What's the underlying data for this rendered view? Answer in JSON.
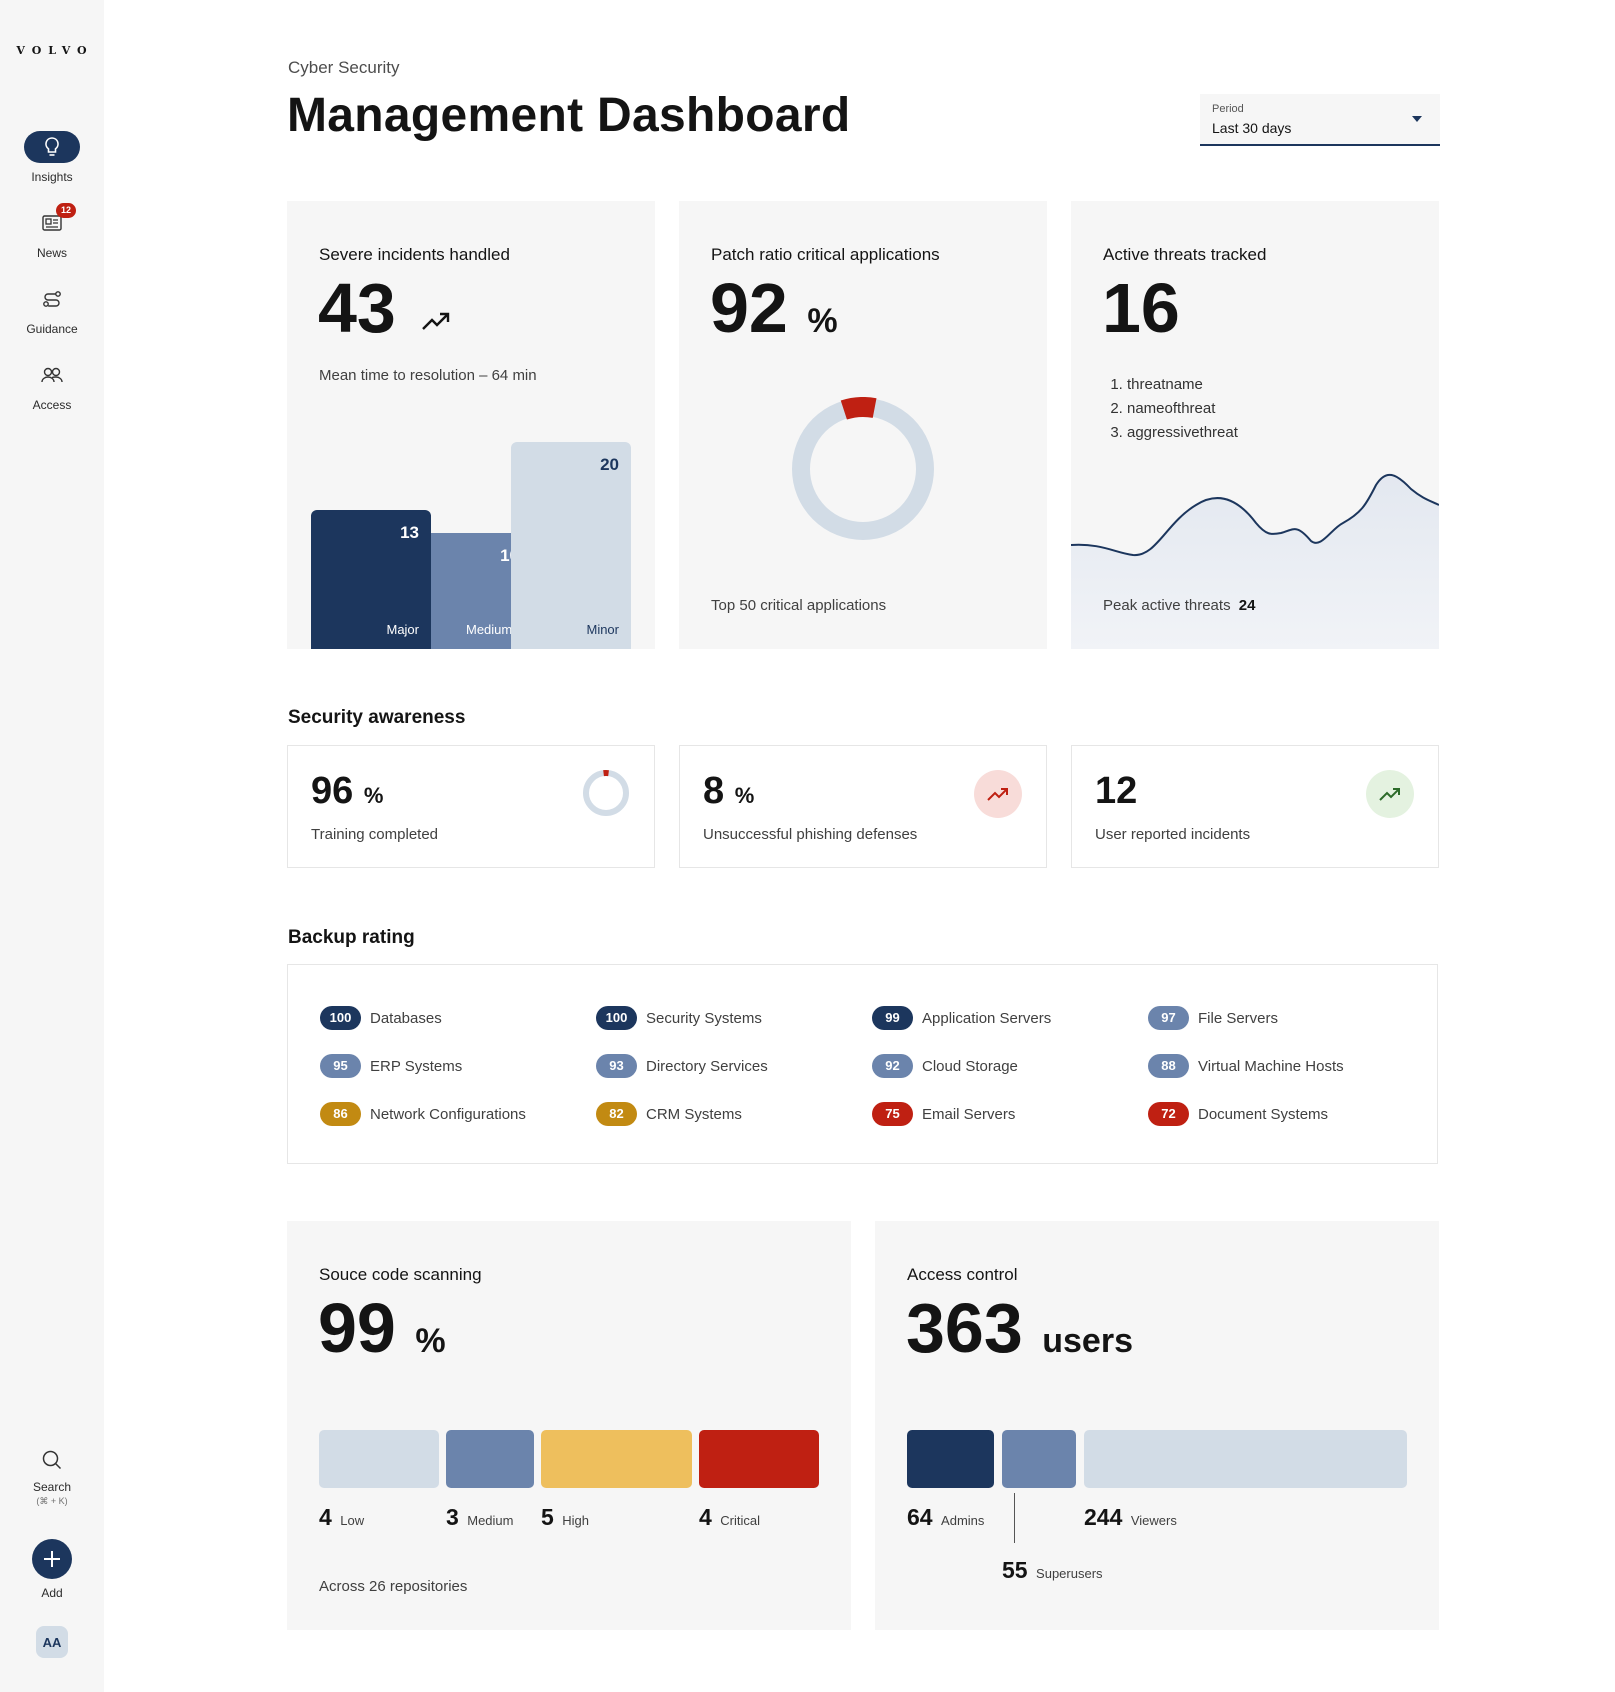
{
  "brand": "VOLVO",
  "colors": {
    "navy": "#1c365d",
    "slate": "#6b84ac",
    "light": "#d2dce6",
    "amber": "#eebf5d",
    "red": "#bf2012",
    "gold": "#c28a12"
  },
  "sidebar": {
    "items": [
      {
        "label": "Insights",
        "icon": "lightbulb-icon",
        "active": true
      },
      {
        "label": "News",
        "icon": "newspaper-icon",
        "badge": "12"
      },
      {
        "label": "Guidance",
        "icon": "route-icon"
      },
      {
        "label": "Access",
        "icon": "users-icon"
      }
    ],
    "search": {
      "label": "Search",
      "shortcut": "(⌘ + K)"
    },
    "add": {
      "label": "Add"
    },
    "avatar": "AA"
  },
  "header": {
    "eyebrow": "Cyber Security",
    "title": "Management Dashboard",
    "period": {
      "label": "Period",
      "value": "Last 30 days"
    }
  },
  "kpis": {
    "incidents": {
      "title": "Severe incidents handled",
      "value": "43",
      "subtitle": "Mean time to resolution – 64 min",
      "bars": [
        {
          "label": "Major",
          "value": 13
        },
        {
          "label": "Medium",
          "value": 10
        },
        {
          "label": "Minor",
          "value": 20
        }
      ]
    },
    "patch": {
      "title": "Patch ratio critical applications",
      "value": "92",
      "unit": "%",
      "subtitle": "Top 50 critical applications",
      "unpatched_fraction": 0.08
    },
    "threats": {
      "title": "Active threats tracked",
      "value": "16",
      "list": [
        "threatname",
        "nameofthreat",
        "aggressivethreat"
      ],
      "peak_label": "Peak active threats",
      "peak_value": "24"
    }
  },
  "awareness": {
    "title": "Security awareness",
    "cards": [
      {
        "value": "96",
        "unit": "%",
        "label": "Training completed",
        "incomplete_fraction": 0.04
      },
      {
        "value": "8",
        "unit": "%",
        "label": "Unsuccessful phishing defenses",
        "trend": "up"
      },
      {
        "value": "12",
        "unit": "",
        "label": "User reported incidents",
        "trend": "up"
      }
    ]
  },
  "backup": {
    "title": "Backup rating",
    "columns": [
      [
        {
          "score": "100",
          "label": "Databases",
          "level": "high"
        },
        {
          "score": "95",
          "label": "ERP Systems",
          "level": "mid"
        },
        {
          "score": "86",
          "label": "Network Configurations",
          "level": "warn"
        }
      ],
      [
        {
          "score": "100",
          "label": "Security Systems",
          "level": "high"
        },
        {
          "score": "93",
          "label": "Directory Services",
          "level": "mid"
        },
        {
          "score": "82",
          "label": "CRM Systems",
          "level": "warn"
        }
      ],
      [
        {
          "score": "99",
          "label": "Application Servers",
          "level": "high"
        },
        {
          "score": "92",
          "label": "Cloud Storage",
          "level": "mid"
        },
        {
          "score": "75",
          "label": "Email Servers",
          "level": "bad"
        }
      ],
      [
        {
          "score": "97",
          "label": "File Servers",
          "level": "mid"
        },
        {
          "score": "88",
          "label": "Virtual Machine Hosts",
          "level": "mid"
        },
        {
          "score": "72",
          "label": "Document Systems",
          "level": "bad"
        }
      ]
    ]
  },
  "source_scan": {
    "title": "Souce code scanning",
    "value": "99",
    "unit": "%",
    "segments": [
      {
        "count": "4",
        "label": "Low"
      },
      {
        "count": "3",
        "label": "Medium"
      },
      {
        "count": "5",
        "label": "High"
      },
      {
        "count": "4",
        "label": "Critical"
      }
    ],
    "footer": "Across 26 repositories"
  },
  "access": {
    "title": "Access control",
    "value": "363",
    "unit": "users",
    "segments": [
      {
        "count": "64",
        "label": "Admins"
      },
      {
        "count": "55",
        "label": "Superusers"
      },
      {
        "count": "244",
        "label": "Viewers"
      }
    ]
  }
}
